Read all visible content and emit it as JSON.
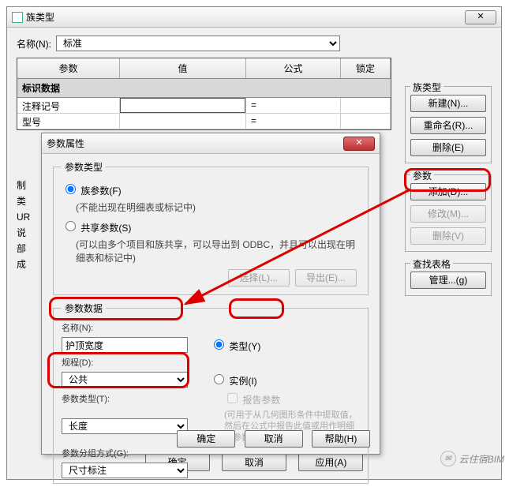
{
  "outer": {
    "title": "族类型",
    "name_label": "名称(N):",
    "name_value": "标准",
    "table": {
      "headers": {
        "param": "参数",
        "value": "值",
        "formula": "公式",
        "lock": "锁定"
      },
      "section": "标识数据",
      "rows": [
        {
          "label": "注释记号",
          "value": "",
          "eq": "="
        },
        {
          "label": "型号",
          "value": "",
          "eq": "="
        }
      ],
      "side_labels": [
        "制",
        "类",
        "UR",
        "说",
        "部",
        "成"
      ]
    },
    "groups": {
      "family_type": {
        "title": "族类型",
        "new": "新建(N)...",
        "rename": "重命名(R)...",
        "delete": "删除(E)"
      },
      "param": {
        "title": "参数",
        "add": "添加(D)...",
        "modify": "修改(M)...",
        "delete": "删除(V)"
      },
      "lookup": {
        "title": "查找表格",
        "manage": "管理...(g)"
      }
    },
    "buttons": {
      "ok": "确定",
      "cancel": "取消",
      "apply": "应用(A)"
    }
  },
  "inner": {
    "title": "参数属性",
    "ptype": {
      "legend": "参数类型",
      "fam_radio": "族参数(F)",
      "fam_hint": "(不能出现在明细表或标记中)",
      "shared_radio": "共享参数(S)",
      "shared_hint": "(可以由多个项目和族共享，可以导出到 ODBC，并且可以出现在明细表和标记中)",
      "select": "选择(L)...",
      "export": "导出(E)..."
    },
    "pdata": {
      "legend": "参数数据",
      "name_cap": "名称(N):",
      "name_value": "护顶宽度",
      "disc_cap": "规程(D):",
      "disc_value": "公共",
      "ptype_cap": "参数类型(T):",
      "ptype_value": "长度",
      "group_cap": "参数分组方式(G):",
      "group_value": "尺寸标注",
      "type_radio": "类型(Y)",
      "inst_radio": "实例(I)",
      "report_chk": "报告参数",
      "report_hint": "(可用于从几何图形条件中提取值，然后在公式中报告此值或用作明细表参数)"
    },
    "buttons": {
      "ok": "确定",
      "cancel": "取消",
      "help": "帮助(H)"
    }
  },
  "watermark": "云住宿BIM"
}
